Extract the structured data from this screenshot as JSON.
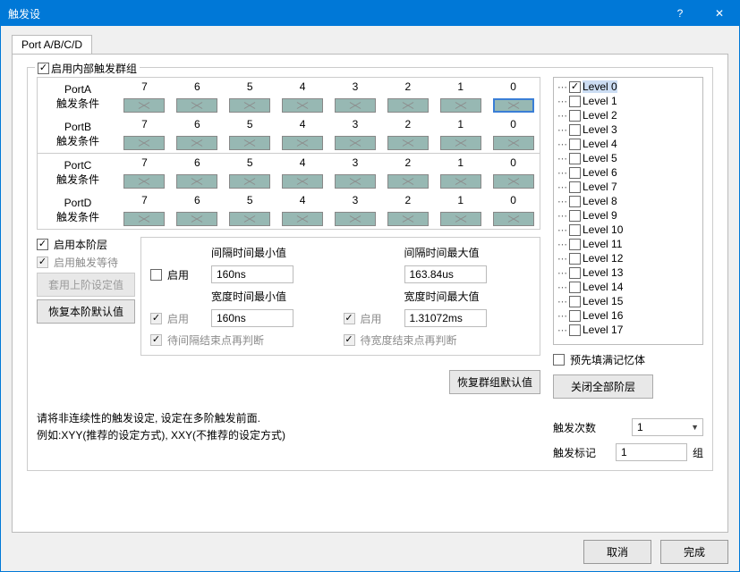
{
  "window": {
    "title": "触发设",
    "help": "?",
    "close": "✕"
  },
  "tab": {
    "label": "Port A/B/C/D"
  },
  "enable_group": {
    "label": "启用内部触发群组"
  },
  "bits": [
    "7",
    "6",
    "5",
    "4",
    "3",
    "2",
    "1",
    "0"
  ],
  "ports": {
    "a": {
      "name": "PortA",
      "cond": "触发条件"
    },
    "b": {
      "name": "PortB",
      "cond": "触发条件"
    },
    "c": {
      "name": "PortC",
      "cond": "触发条件"
    },
    "d": {
      "name": "PortD",
      "cond": "触发条件"
    }
  },
  "opts": {
    "enable_level": "启用本阶层",
    "enable_wait": "启用触发等待",
    "apply_prev": "套用上阶设定值",
    "restore_level": "恢复本阶默认值"
  },
  "timing": {
    "enable": "启用",
    "gap_min_lbl": "间隔时间最小值",
    "gap_min_val": "160ns",
    "gap_max_lbl": "间隔时间最大值",
    "gap_max_val": "163.84us",
    "wid_min_lbl": "宽度时间最小值",
    "wid_min_val": "160ns",
    "wid_max_lbl": "宽度时间最大值",
    "wid_max_val": "1.31072ms",
    "gap_judge": "待间隔结束点再判断",
    "wid_judge": "待宽度结束点再判断"
  },
  "restore_group": "恢复群组默认值",
  "hint1": "请将非连续性的触发设定, 设定在多阶触发前面.",
  "hint2": "例如:XYY(推荐的设定方式), XXY(不推荐的设定方式)",
  "levels": [
    "Level 0",
    "Level 1",
    "Level 2",
    "Level 3",
    "Level 4",
    "Level 5",
    "Level 6",
    "Level 7",
    "Level 8",
    "Level 9",
    "Level 10",
    "Level 11",
    "Level 12",
    "Level 13",
    "Level 14",
    "Level 15",
    "Level 16",
    "Level 17"
  ],
  "prefill": "预先填满记忆体",
  "close_all_levels": "关闭全部阶层",
  "trig_count_lbl": "触发次数",
  "trig_count_val": "1",
  "trig_mark_lbl": "触发标记",
  "trig_mark_val": "1",
  "trig_mark_unit": "组",
  "buttons": {
    "cancel": "取消",
    "finish": "完成"
  }
}
